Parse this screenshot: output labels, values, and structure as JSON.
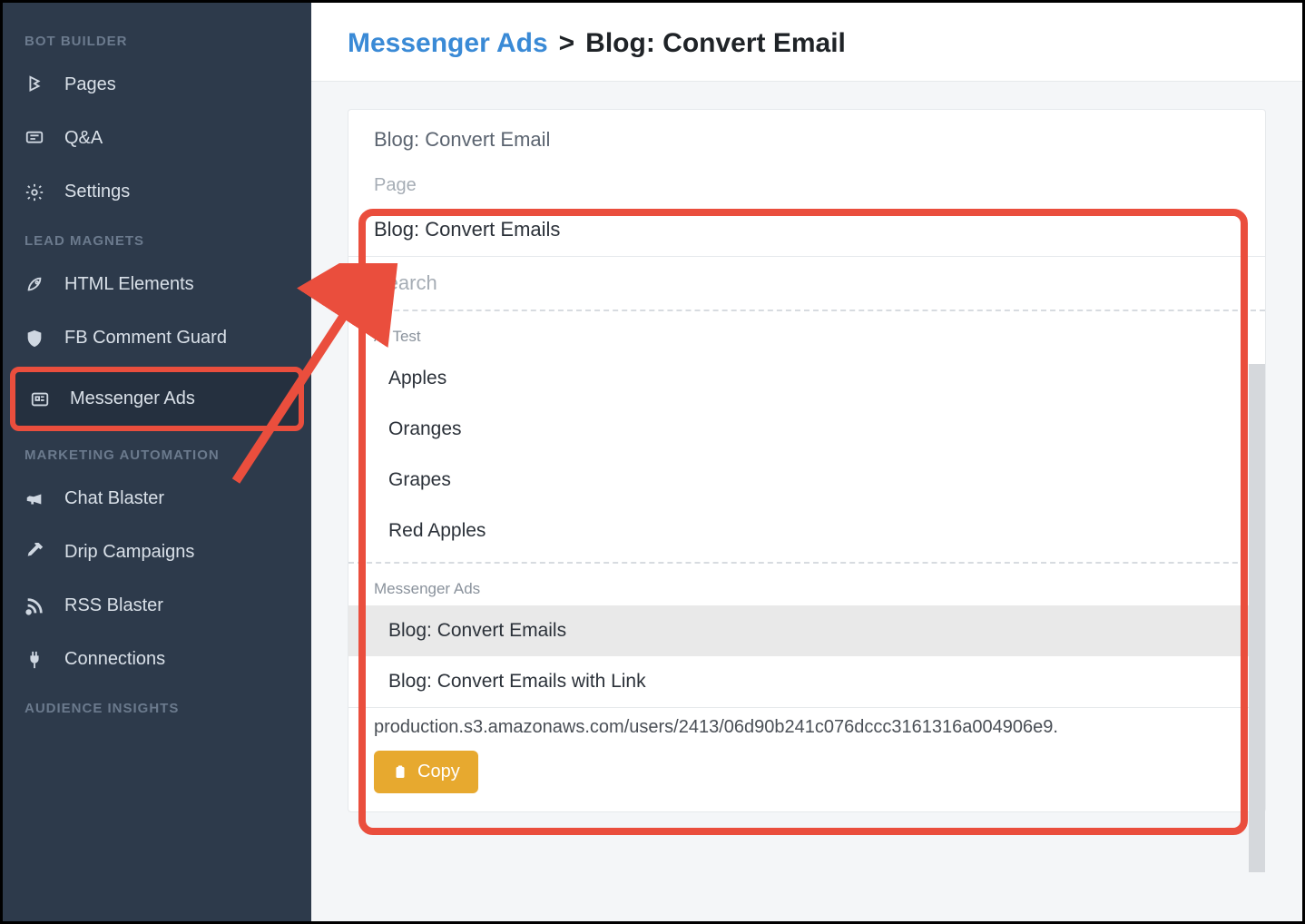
{
  "sidebar": {
    "sections": [
      {
        "title": "BOT BUILDER",
        "items": [
          {
            "name": "pages",
            "label": "Pages",
            "icon": "pages-icon"
          },
          {
            "name": "qa",
            "label": "Q&A",
            "icon": "chat-icon"
          },
          {
            "name": "settings",
            "label": "Settings",
            "icon": "gear-icon"
          }
        ]
      },
      {
        "title": "LEAD MAGNETS",
        "items": [
          {
            "name": "html-elements",
            "label": "HTML Elements",
            "icon": "rocket-icon"
          },
          {
            "name": "fb-comment-guard",
            "label": "FB Comment Guard",
            "icon": "shield-icon"
          },
          {
            "name": "messenger-ads",
            "label": "Messenger Ads",
            "icon": "news-icon",
            "highlighted": true
          }
        ]
      },
      {
        "title": "MARKETING AUTOMATION",
        "items": [
          {
            "name": "chat-blaster",
            "label": "Chat Blaster",
            "icon": "megaphone-icon"
          },
          {
            "name": "drip-campaigns",
            "label": "Drip Campaigns",
            "icon": "eyedropper-icon"
          },
          {
            "name": "rss-blaster",
            "label": "RSS Blaster",
            "icon": "rss-icon"
          },
          {
            "name": "connections",
            "label": "Connections",
            "icon": "plug-icon"
          }
        ]
      },
      {
        "title": "AUDIENCE INSIGHTS",
        "items": []
      }
    ]
  },
  "breadcrumb": {
    "root": "Messenger Ads",
    "separator": ">",
    "leaf": "Blog: Convert Email"
  },
  "card": {
    "title": "Blog: Convert Email",
    "page_label": "Page",
    "selected_page": "Blog: Convert Emails",
    "search_placeholder": "Search",
    "groups": [
      {
        "label": "AI Test",
        "options": [
          "Apples",
          "Oranges",
          "Grapes",
          "Red Apples"
        ]
      },
      {
        "label": "Messenger Ads",
        "options": [
          "Blog: Convert Emails",
          "Blog: Convert Emails with Link"
        ],
        "hovered_index": 0
      }
    ],
    "cutoff_text": "production.s3.amazonaws.com/users/2413/06d90b241c076dccc3161316a004906e9.",
    "copy_label": "Copy"
  },
  "colors": {
    "highlight": "#ea4e3d",
    "accent_link": "#3a8ad6",
    "copy_btn": "#e7a92f",
    "sidebar_bg": "#2d3a4b"
  }
}
